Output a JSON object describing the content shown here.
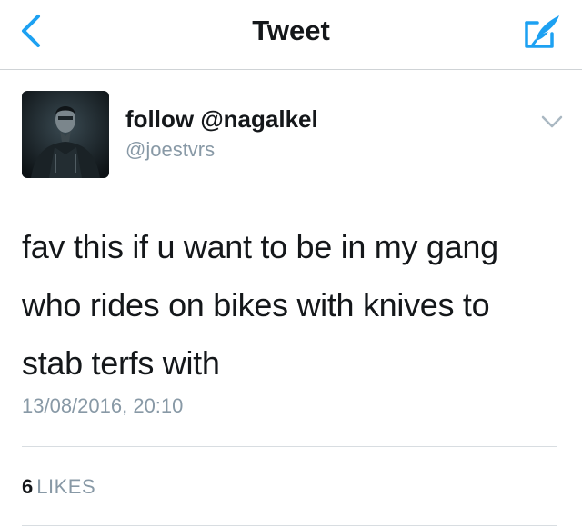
{
  "nav": {
    "title": "Tweet",
    "back_icon": "chevron-left-icon",
    "compose_icon": "compose-tweet-icon",
    "accent_color": "#1da1f2"
  },
  "tweet": {
    "author_name": "follow @nagalkel",
    "author_handle": "@joestvrs",
    "text": "fav this if u want to be in my gang who rides on bikes with knives to stab terfs with",
    "timestamp": "13/08/2016, 20:10",
    "likes_count": "6",
    "likes_label": "LIKES",
    "more_icon": "chevron-down-icon"
  }
}
